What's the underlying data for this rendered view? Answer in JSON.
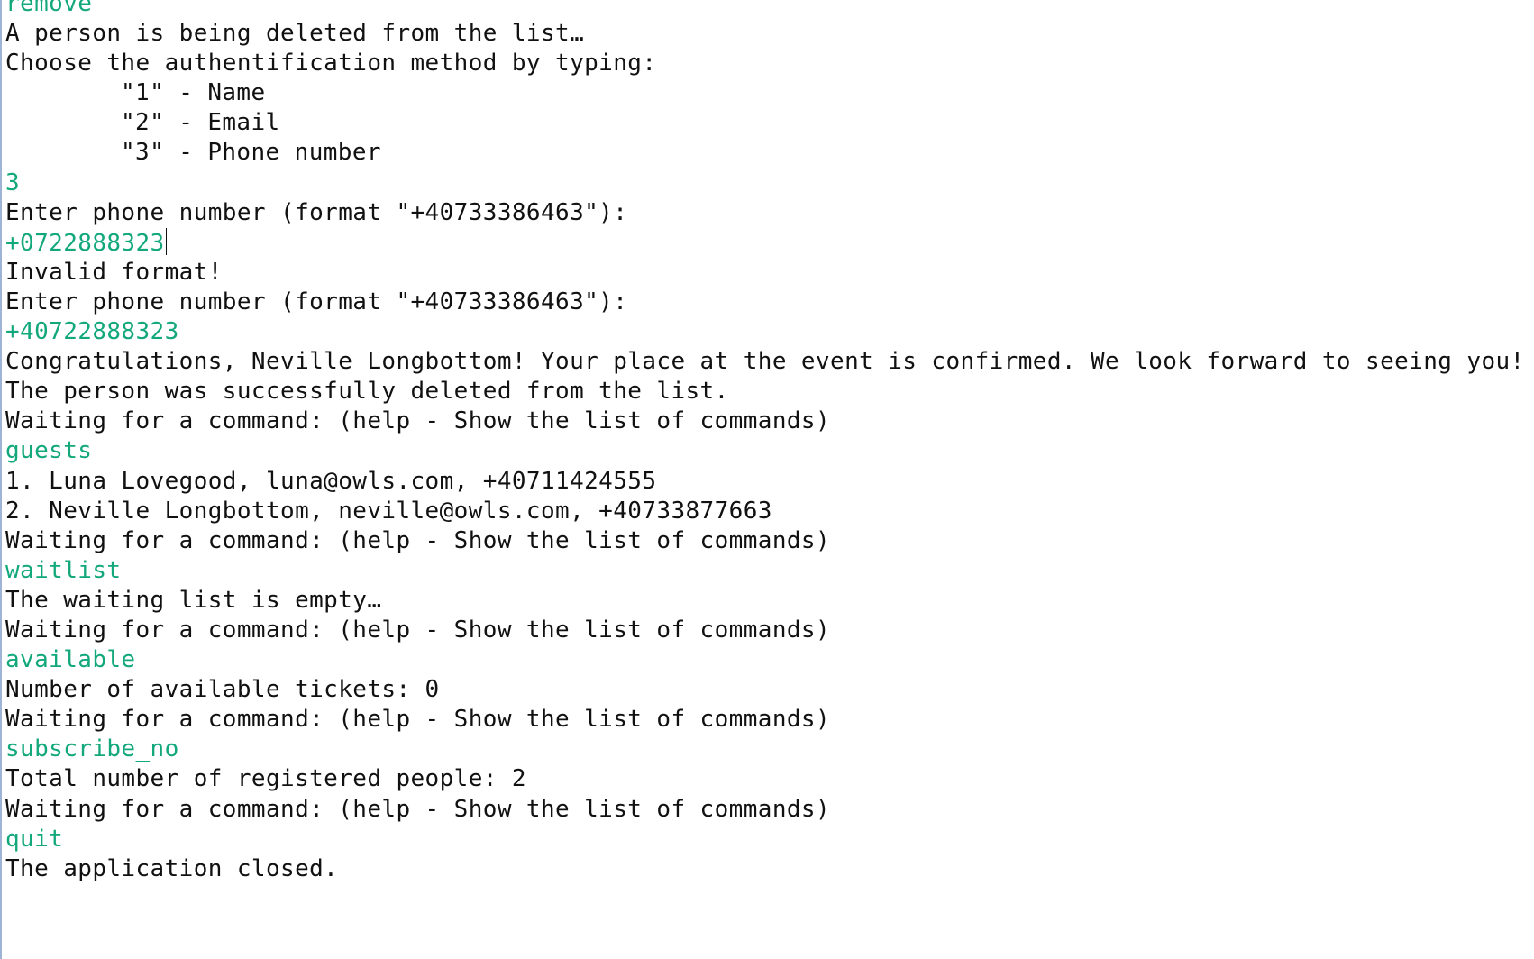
{
  "console": {
    "lines": [
      {
        "type": "input",
        "text": "remove"
      },
      {
        "type": "output",
        "text": "A person is being deleted from the list…"
      },
      {
        "type": "output",
        "text": "Choose the authentification method by typing:"
      },
      {
        "type": "output",
        "text": "\"1\" - Name",
        "indent": true
      },
      {
        "type": "output",
        "text": "\"2\" - Email",
        "indent": true
      },
      {
        "type": "output",
        "text": "\"3\" - Phone number",
        "indent": true
      },
      {
        "type": "input",
        "text": "3"
      },
      {
        "type": "output",
        "text": "Enter phone number (format \"+40733386463\"):"
      },
      {
        "type": "input",
        "text": "+0722888323",
        "caret": true
      },
      {
        "type": "output",
        "text": "Invalid format!"
      },
      {
        "type": "output",
        "text": "Enter phone number (format \"+40733386463\"):"
      },
      {
        "type": "input",
        "text": "+40722888323"
      },
      {
        "type": "output",
        "text": "Congratulations, Neville Longbottom! Your place at the event is confirmed. We look forward to seeing you!"
      },
      {
        "type": "output",
        "text": "The person was successfully deleted from the list."
      },
      {
        "type": "output",
        "text": "Waiting for a command: (help - Show the list of commands)"
      },
      {
        "type": "input",
        "text": "guests"
      },
      {
        "type": "output",
        "text": "1. Luna Lovegood, luna@owls.com, +40711424555"
      },
      {
        "type": "output",
        "text": "2. Neville Longbottom, neville@owls.com, +40733877663"
      },
      {
        "type": "output",
        "text": "Waiting for a command: (help - Show the list of commands)"
      },
      {
        "type": "input",
        "text": "waitlist"
      },
      {
        "type": "output",
        "text": "The waiting list is empty…"
      },
      {
        "type": "output",
        "text": "Waiting for a command: (help - Show the list of commands)"
      },
      {
        "type": "input",
        "text": "available"
      },
      {
        "type": "output",
        "text": "Number of available tickets: 0"
      },
      {
        "type": "output",
        "text": "Waiting for a command: (help - Show the list of commands)"
      },
      {
        "type": "input",
        "text": "subscribe_no"
      },
      {
        "type": "output",
        "text": "Total number of registered people: 2"
      },
      {
        "type": "output",
        "text": "Waiting for a command: (help - Show the list of commands)"
      },
      {
        "type": "input",
        "text": "quit"
      },
      {
        "type": "output",
        "text": "The application closed."
      }
    ]
  },
  "colors": {
    "input_text": "#13a87c",
    "output_text": "#111111",
    "background": "#ffffff",
    "left_border": "#9fb3d6"
  }
}
